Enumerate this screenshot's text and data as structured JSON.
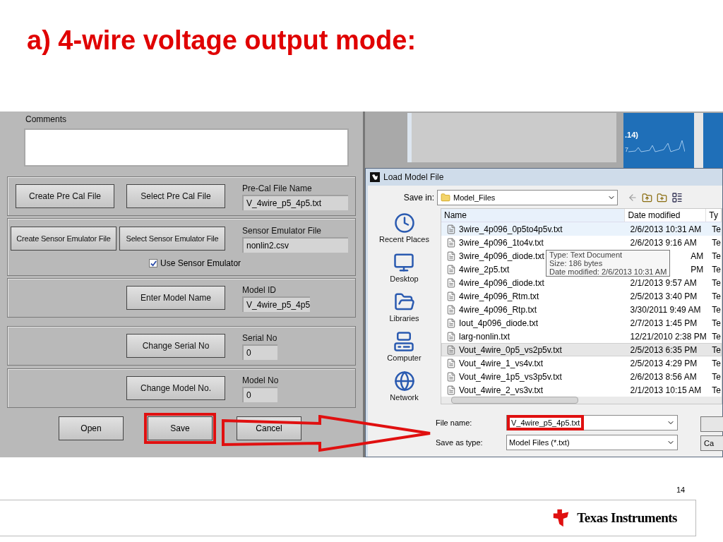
{
  "slide": {
    "title": "a) 4-wire voltage output mode:",
    "page_number": "14",
    "logo_text": "Texas Instruments"
  },
  "panel": {
    "comments_label": "Comments",
    "groups": [
      {
        "buttons": [
          "Create Pre Cal File",
          "Select Pre Cal File"
        ],
        "field_label": "Pre-Cal File Name",
        "field_value": "V_4wire_p5_4p5.txt"
      },
      {
        "buttons": [
          "Create Sensor Emulator File",
          "Select Sensor Emulator File"
        ],
        "field_label": "Sensor Emulator File",
        "field_value": "nonlin2.csv",
        "checkbox": {
          "label": "Use Sensor Emulator",
          "checked": true
        }
      },
      {
        "buttons": [
          "Enter Model Name"
        ],
        "field_label": "Model ID",
        "field_value": "V_4wire_p5_4p5"
      },
      {
        "buttons": [
          "Change Serial No"
        ],
        "field_label": "Serial No",
        "field_value": "0"
      },
      {
        "buttons": [
          "Change Model No."
        ],
        "field_label": "Model No",
        "field_value": "0"
      }
    ],
    "bottom_buttons": [
      {
        "label": "Open",
        "highlighted": false
      },
      {
        "label": "Save",
        "highlighted": true
      },
      {
        "label": "Cancel",
        "highlighted": false
      }
    ]
  },
  "background_app": {
    "chart_label": ".14)",
    "chart_sublabel": "7"
  },
  "dialog": {
    "title": "Load Model File",
    "save_in_label": "Save in:",
    "save_in_value": "Model_Files",
    "places": [
      "Recent Places",
      "Desktop",
      "Libraries",
      "Computer",
      "Network"
    ],
    "columns": [
      "Name",
      "Date modified",
      "Ty"
    ],
    "rows": [
      {
        "name": "3wire_4p096_0p5to4p5v.txt",
        "date": "2/6/2013 10:31 AM",
        "type": "Te",
        "hovered": true,
        "selected": false
      },
      {
        "name": "3wire_4p096_1to4v.txt",
        "date": "2/6/2013 9:16 AM",
        "type": "Te",
        "hovered": false,
        "selected": false
      },
      {
        "name": "3wire_4p096_diode.txt",
        "date": "AM",
        "type": "Te",
        "hovered": false,
        "selected": false
      },
      {
        "name": "4wire_2p5.txt",
        "date": "PM",
        "type": "Te",
        "hovered": false,
        "selected": false
      },
      {
        "name": "4wire_4p096_diode.txt",
        "date": "2/1/2013 9:57 AM",
        "type": "Te",
        "hovered": false,
        "selected": false
      },
      {
        "name": "4wire_4p096_Rtm.txt",
        "date": "2/5/2013 3:40 PM",
        "type": "Te",
        "hovered": false,
        "selected": false
      },
      {
        "name": "4wire_4p096_Rtp.txt",
        "date": "3/30/2011 9:49 AM",
        "type": "Te",
        "hovered": false,
        "selected": false
      },
      {
        "name": "Iout_4p096_diode.txt",
        "date": "2/7/2013 1:45 PM",
        "type": "Te",
        "hovered": false,
        "selected": false
      },
      {
        "name": "larg-nonlin.txt",
        "date": "12/21/2010 2:38 PM",
        "type": "Te",
        "hovered": false,
        "selected": false
      },
      {
        "name": "Vout_4wire_0p5_vs2p5v.txt",
        "date": "2/5/2013 6:35 PM",
        "type": "Te",
        "hovered": false,
        "selected": true
      },
      {
        "name": "Vout_4wire_1_vs4v.txt",
        "date": "2/5/2013 4:29 PM",
        "type": "Te",
        "hovered": false,
        "selected": false
      },
      {
        "name": "Vout_4wire_1p5_vs3p5v.txt",
        "date": "2/6/2013 8:56 AM",
        "type": "Te",
        "hovered": false,
        "selected": false
      },
      {
        "name": "Vout_4wire_2_vs3v.txt",
        "date": "2/1/2013 10:15 AM",
        "type": "Te",
        "hovered": false,
        "selected": false
      }
    ],
    "tooltip": [
      "Type: Text Document",
      "Size: 186 bytes",
      "Date modified: 2/6/2013 10:31 AM"
    ],
    "file_name_label": "File name:",
    "file_name_value": "V_4wire_p5_4p5.txt",
    "file_name_highlighted": true,
    "save_type_label": "Save as type:",
    "save_type_value": "Model Files (*.txt)",
    "side_buttons": [
      "Ca"
    ]
  }
}
